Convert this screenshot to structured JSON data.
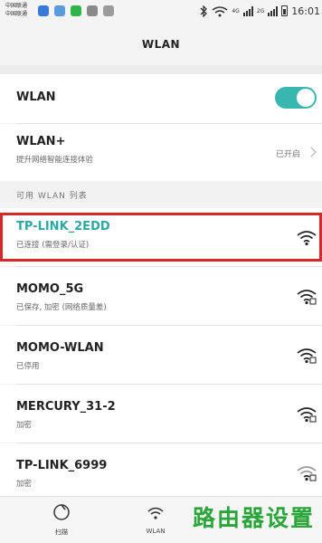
{
  "status_bar": {
    "carrier_1": "中国联通",
    "carrier_2": "中国联通",
    "network_tag_1": "4G",
    "network_tag_2": "2G",
    "time": "16:01"
  },
  "header": {
    "title": "WLAN"
  },
  "wlan_toggle": {
    "label": "WLAN",
    "enabled": true,
    "accent_color": "#37b7b0"
  },
  "wlan_plus": {
    "label": "WLAN+",
    "description": "提升网络智能连接体验",
    "status": "已开启"
  },
  "section": {
    "title": "可用 WLAN 列表"
  },
  "networks": [
    {
      "ssid": "TP-LINK_2EDD",
      "status": "已连接 (需登录/认证)",
      "connected": true,
      "locked": false
    },
    {
      "ssid": "MOMO_5G",
      "status": "已保存, 加密 (网络质量差)",
      "connected": false,
      "locked": true
    },
    {
      "ssid": "MOMO-WLAN",
      "status": "已停用",
      "connected": false,
      "locked": true
    },
    {
      "ssid": "MERCURY_31-2",
      "status": "加密",
      "connected": false,
      "locked": true
    },
    {
      "ssid": "TP-LINK_6999",
      "status": "加密",
      "connected": false,
      "locked": true
    }
  ],
  "bottom_nav": {
    "scan_label": "扫描",
    "wlan_label": "WLAN"
  },
  "watermark": {
    "text": "路由器设置",
    "color": "#2aa53a"
  },
  "highlight_color": "#d9262b"
}
